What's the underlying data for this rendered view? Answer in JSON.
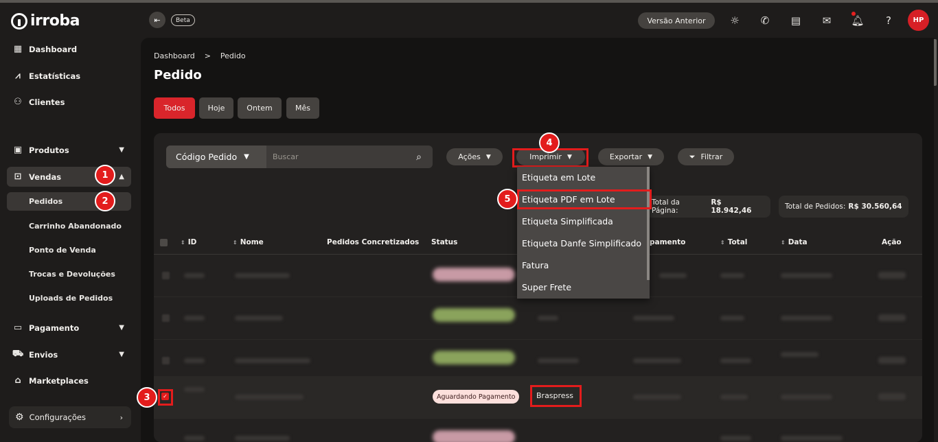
{
  "brand": {
    "name": "irroba"
  },
  "sidebar": {
    "items": [
      {
        "label": "Dashboard",
        "icon": "grid-icon"
      },
      {
        "label": "Estatísticas",
        "icon": "chart-icon"
      },
      {
        "label": "Clientes",
        "icon": "users-icon"
      },
      {
        "label": "Produtos",
        "icon": "box-icon"
      },
      {
        "label": "Vendas",
        "icon": "bag-icon"
      },
      {
        "label": "Pagamento",
        "icon": "card-icon"
      },
      {
        "label": "Envios",
        "icon": "truck-icon"
      },
      {
        "label": "Marketplaces",
        "icon": "store-icon"
      }
    ],
    "vendas_sub": [
      {
        "label": "Pedidos"
      },
      {
        "label": "Carrinho Abandonado"
      },
      {
        "label": "Ponto de Venda"
      },
      {
        "label": "Trocas e Devoluções"
      },
      {
        "label": "Uploads de Pedidos"
      }
    ],
    "config_label": "Configurações"
  },
  "header": {
    "beta": "Beta",
    "versao_anterior": "Versão Anterior",
    "avatar_initials": "HP"
  },
  "breadcrumb": {
    "root": "Dashboard",
    "separator": ">",
    "current": "Pedido"
  },
  "page_title": "Pedido",
  "period_filters": [
    "Todos",
    "Hoje",
    "Ontem",
    "Mês"
  ],
  "toolbar": {
    "search_field": "Código Pedido",
    "search_placeholder": "Buscar",
    "acoes": "Ações",
    "imprimir": "Imprimir",
    "exportar": "Exportar",
    "filtrar": "Filtrar"
  },
  "imprimir_menu": [
    "Etiqueta em Lote",
    "Etiqueta PDF em Lote",
    "Etiqueta Simplificada",
    "Etiqueta Danfe Simplificado",
    "Fatura",
    "Super Frete"
  ],
  "totals": {
    "pagina_label": "Total da Página:",
    "pagina_value": "R$ 18.942,46",
    "pedidos_label": "Total de Pedidos:",
    "pedidos_value": "R$ 30.560,64"
  },
  "table": {
    "headers": [
      "ID",
      "Nome",
      "Pedidos Concretizados",
      "Status",
      "pamento",
      "Total",
      "Data",
      "Ação"
    ],
    "selected_row": {
      "status": "Aguardando Pagamento",
      "shipping": "Braspress"
    }
  },
  "annotations": [
    "1",
    "2",
    "3",
    "4",
    "5"
  ],
  "colors": {
    "accent": "#d9252b",
    "annotation": "#e31c1c"
  }
}
